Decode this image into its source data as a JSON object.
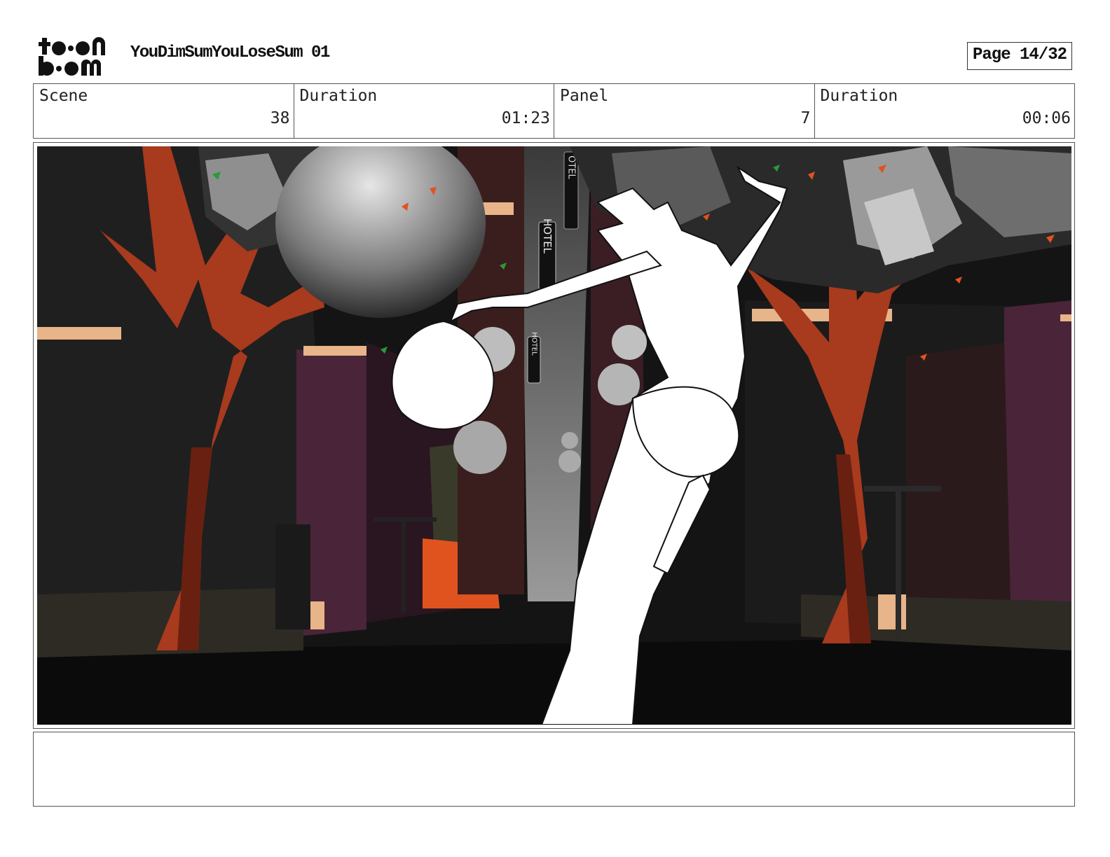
{
  "header": {
    "logo_text": "toon boom",
    "project_title": "YouDimSumYouLoseSum 01",
    "page_indicator": "Page 14/32"
  },
  "info_bar": {
    "scene_label": "Scene",
    "scene_value": "38",
    "scene_duration_label": "Duration",
    "scene_duration_value": "01:23",
    "panel_label": "Panel",
    "panel_value": "7",
    "panel_duration_label": "Duration",
    "panel_duration_value": "00:06"
  },
  "panel": {
    "sign_upper": "HOTEL",
    "sign_lower": "HOTEL",
    "sign_far": "OTEL"
  },
  "notes": {
    "text": ""
  },
  "colors": {
    "tree_trunk": "#a83a1e",
    "building_purple": "#4a2438",
    "accent_orange": "#e0531e",
    "trim_peach": "#e8b489",
    "sky_gray": "#8a8a8a"
  }
}
